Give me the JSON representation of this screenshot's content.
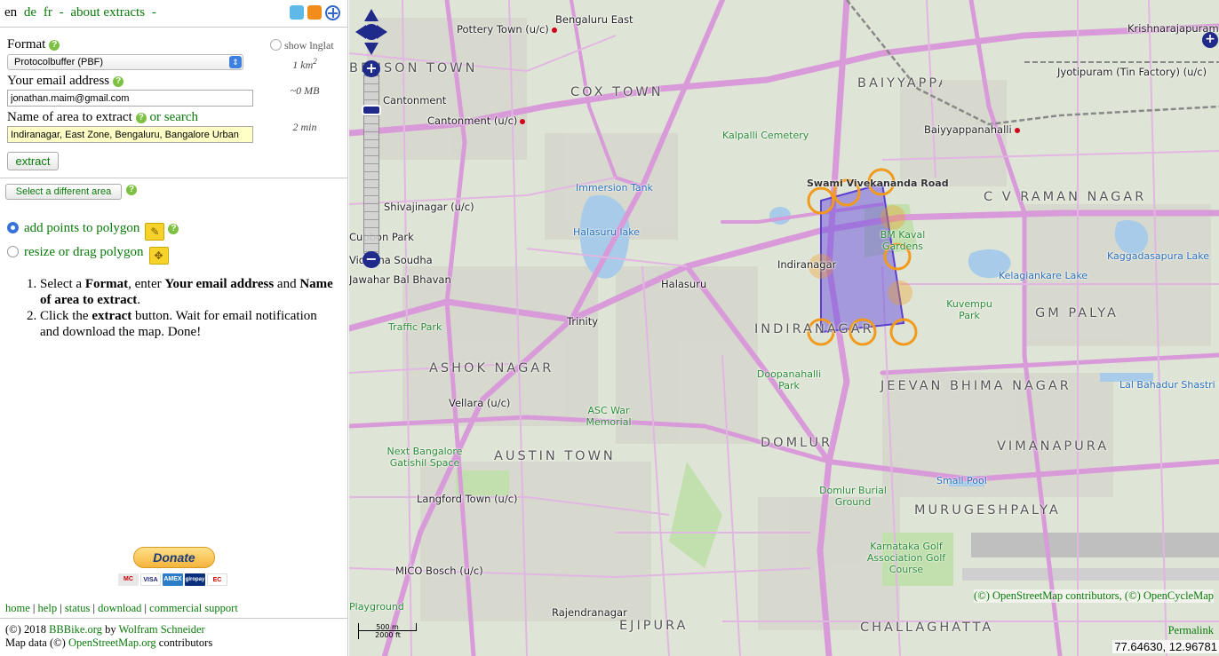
{
  "header": {
    "lang_current": "en",
    "lang_links": [
      "de",
      "fr"
    ],
    "about_link": "about extracts",
    "separator": "-",
    "icons": [
      "twitter-icon",
      "rss-icon",
      "osm-icon"
    ]
  },
  "form": {
    "format_label": "Format",
    "format_value": "Protocolbuffer (PBF)",
    "show_lnglat_label": "show lnglat",
    "area_size": "1 km",
    "area_size_sup": "2",
    "email_label": "Your email address",
    "email_value": "jonathan.maim@gmail.com",
    "file_size": "~0 MB",
    "area_name_label": "Name of area to extract",
    "or_search": "or search",
    "area_name_value": "Indiranagar, East Zone, Bengaluru, Bangalore Urban",
    "time_estimate": "2 min",
    "extract_button": "extract"
  },
  "tools": {
    "select_area_button": "Select a different area",
    "add_points_label": "add points to polygon",
    "resize_label": "resize or drag polygon",
    "selected_mode": "add points to polygon"
  },
  "instructions": {
    "step1": [
      "Select a ",
      "Format",
      ", enter ",
      "Your email address",
      " and ",
      "Name of area to extract",
      "."
    ],
    "step2": [
      "Click the ",
      "extract",
      " button. Wait for email notification and download the map. Done!"
    ]
  },
  "donate": {
    "button": "Donate",
    "cards": [
      "MC",
      "VISA",
      "AMEX",
      "giropay",
      "EC"
    ]
  },
  "footer": {
    "links": [
      "home",
      "help",
      "status",
      "download",
      "commercial support"
    ],
    "copyright_prefix": "(©) 2018",
    "site": "BBBike.org",
    "by": "by",
    "author": "Wolfram Schneider",
    "mapdata_prefix": "Map data (©)",
    "osm_link": "OpenStreetMap.org",
    "contributors": "contributors"
  },
  "map": {
    "labels": [
      "Bengaluru East",
      "Pottery Town (u/c)",
      "Krishnarajapuram",
      "Jyotipuram (Tin Factory) (u/c)",
      "Cantonment",
      "Cantonment (u/c)",
      "Baiyyappanahalli",
      "Shivajinagar (u/c)",
      "Cubbon Park",
      "Vidhana Soudha",
      "Jawahar Bal Bhavan",
      "Halasuru",
      "Trinity",
      "Indiranagar",
      "Vellara (u/c)",
      "Langford Town (u/c)",
      "MICO Bosch (u/c)",
      "Rajendranagar",
      "Swami Vivekananda Road"
    ],
    "big_labels": [
      "BENSON TOWN",
      "COX TOWN",
      "BAIYYAPPANAHALLI",
      "C V RAMAN NAGAR",
      "GM PALYA",
      "INDIRANAGAR",
      "JEEVAN BHIMA NAGAR",
      "ASHOK NAGAR",
      "AUSTIN TOWN",
      "DOMLUR",
      "VIMANAPURA",
      "MURUGESHPALYA",
      "EJIPURA",
      "CHALLAGHATTA"
    ],
    "green_labels": [
      "Kalpalli Cemetery",
      "Traffic Park",
      "ASC War Memorial",
      "Next Bangalore Gatishil Space",
      "Doopanahalli Park",
      "Domlur Burial Ground",
      "Karnataka Golf Association Golf Course",
      "Kuvempu Park",
      "BM Kaval Gardens",
      "Playground"
    ],
    "water_labels": [
      "Immersion Tank",
      "Halasuru lake",
      "Kaggadasapura Lake",
      "Kelagiankare Lake",
      "Lal Bahadur Shastri C",
      "Small Pool"
    ],
    "scale_top": "500 m",
    "scale_bottom": "2000 ft",
    "attribution": [
      "(©) OpenStreetMap contributors",
      "(©) OpenCycleMap"
    ],
    "permalink": "Permalink",
    "coords": "77.64630, 12.96781",
    "colors": {
      "road": "#d89ad8",
      "polygon": "#6a4fe0",
      "handle": "#f29a1c"
    }
  }
}
